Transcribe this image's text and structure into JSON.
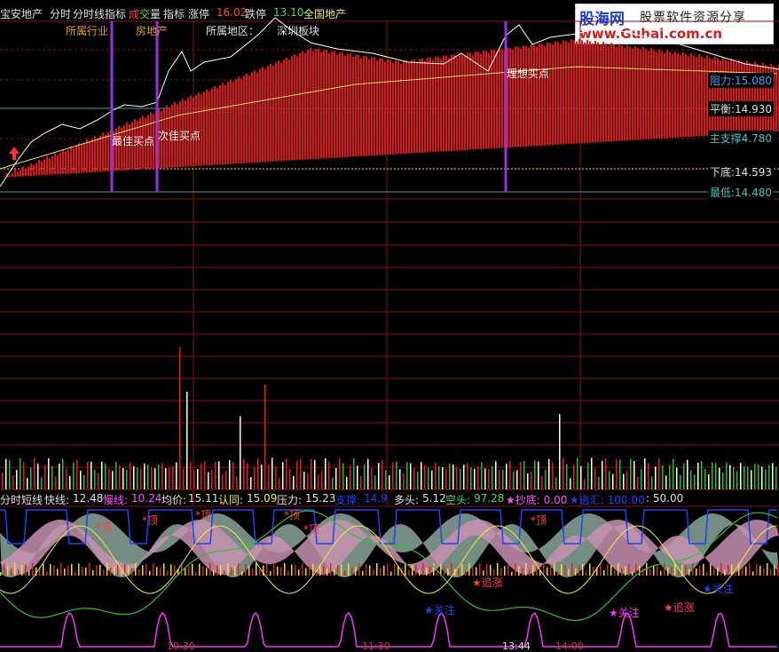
{
  "header": {
    "stock_name": "宝安地产",
    "menu_1": "分时",
    "menu_2": "分时线指标",
    "menu_3_cheng": "成",
    "menu_3_jiao": "交",
    "menu_3_liang": "量",
    "menu_4": "指标",
    "limit_up_label": "涨停",
    "limit_up_value": "16.02",
    "limit_down_label": "跌停",
    "limit_down_value": "13.10",
    "region_text": "全国地产"
  },
  "watermark": {
    "brand": "股海网",
    "slogan": "股票软件资源分享",
    "url": "www.Guhai.com.cn"
  },
  "sector_info": {
    "industry_label": "所属行业",
    "industry_value": "房地产",
    "region_label": "所属地区：",
    "region_value": "深圳板块"
  },
  "price_levels": {
    "resistance": "阻力:15.080",
    "balance": "平衡:14.930",
    "support": "主支撑4.780",
    "bottom": "下底:14.593",
    "lowest": "最低:14.480"
  },
  "annotations": {
    "best_buy": "最佳买点",
    "second_buy": "次佳买点",
    "ideal_buy": "理想买点"
  },
  "indicator_bar": {
    "name": "分时短线",
    "fast_label": "快线:",
    "fast_value": "12.48",
    "slow_label": "慢线:",
    "slow_value": "10.24",
    "avg_label": "均价:",
    "avg_value": "15.11",
    "confirm_label": "认同:",
    "confirm_value": "15.09",
    "pressure_label": "压力:",
    "pressure_value": "15.23",
    "support_label": "支撑:",
    "support_value": "14.9",
    "long_label": "多头:",
    "long_value": "5.12",
    "short_label": "空头:",
    "short_value": "97.28",
    "bottom_pick": "★抄底: 0.00",
    "escape": "★逃汇: 100.00",
    "level": ": 50.00"
  },
  "signals": {
    "top": "*顶",
    "chase": "★追涨",
    "watch": "★关注"
  },
  "x_axis": [
    "10:30",
    "11:30",
    "13:44",
    "14:00"
  ],
  "colors": {
    "bar_red": "#e81010",
    "purple_line": "#9a30e0",
    "grid_red": "#8a1010",
    "price_line": "#ffffff",
    "avg_line": "#f0f040",
    "volume_green": "#20c020",
    "volume_red": "#e02020",
    "fast_green": "#30c030",
    "signal_blue": "#2040ff",
    "signal_magenta": "#ff30ff"
  }
}
